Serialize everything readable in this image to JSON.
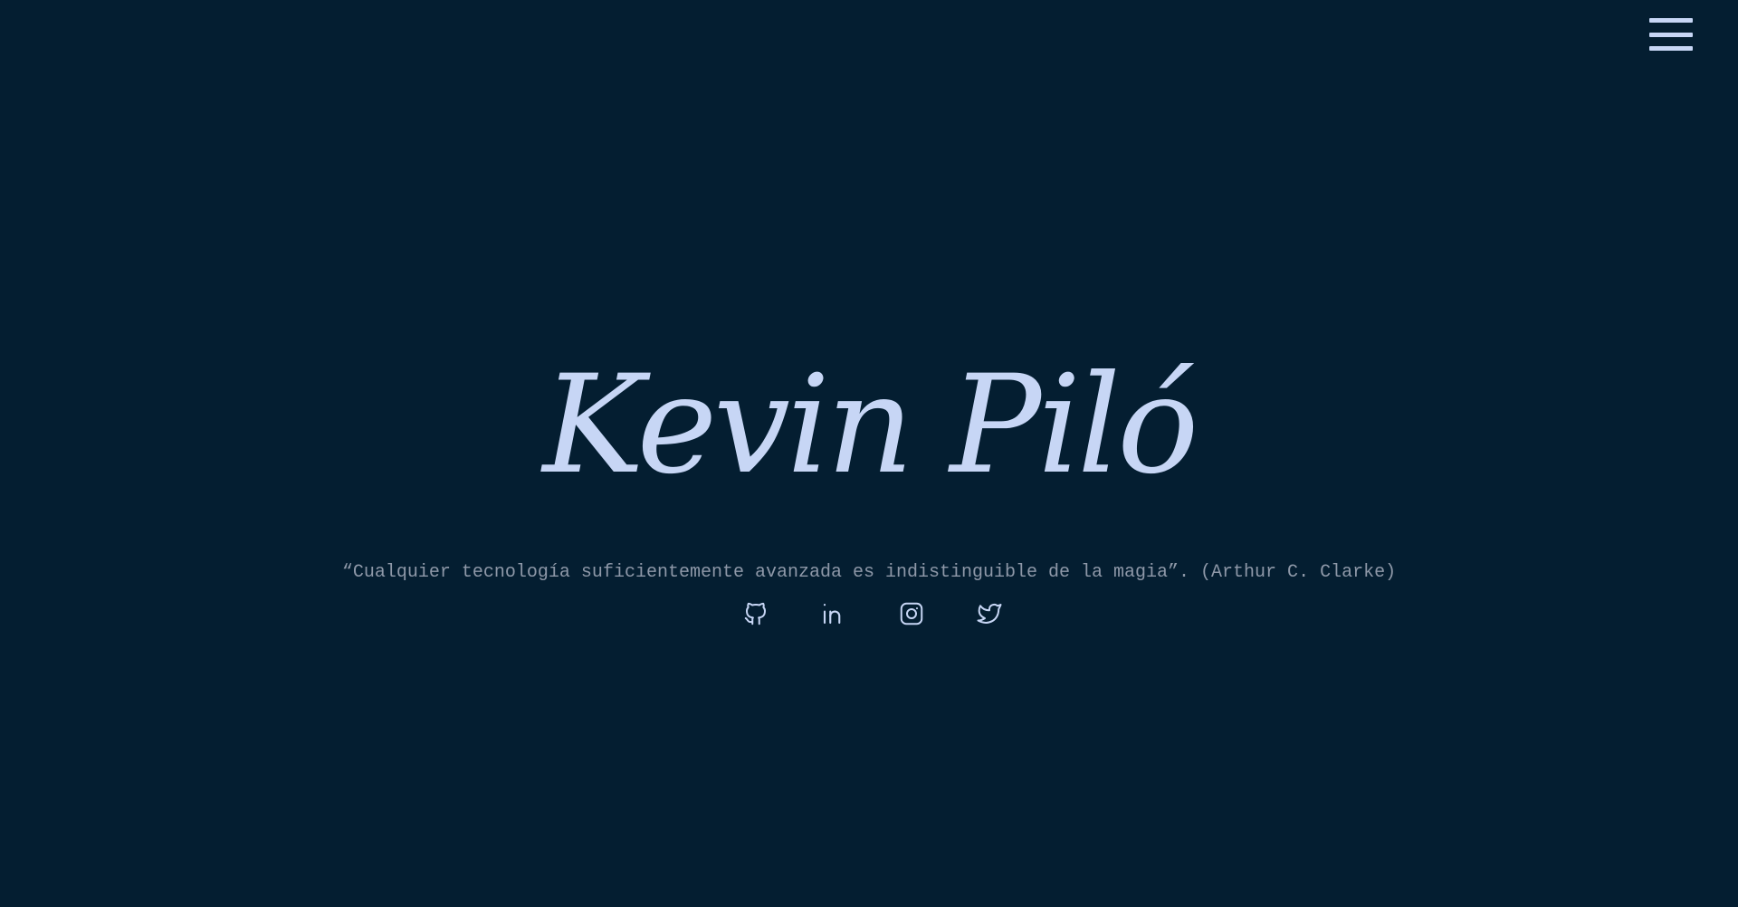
{
  "header": {
    "menu_icon": "hamburger-menu-icon"
  },
  "hero": {
    "name": "Kevin Piló",
    "quote": "“Cualquier tecnología suficientemente avanzada es indistinguible de la magia”. (Arthur C. Clarke)"
  },
  "social": [
    {
      "name": "github",
      "icon": "github-icon"
    },
    {
      "name": "linkedin",
      "icon": "linkedin-icon"
    },
    {
      "name": "instagram",
      "icon": "instagram-icon"
    },
    {
      "name": "twitter",
      "icon": "twitter-icon"
    }
  ],
  "colors": {
    "background": "#041e31",
    "accent": "#c7d6f5",
    "quote_text": "#8e98a8"
  }
}
